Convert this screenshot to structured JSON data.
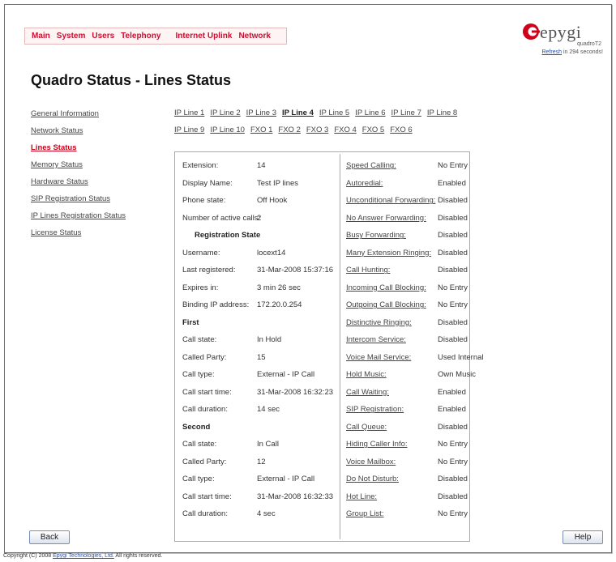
{
  "topnav": [
    "Main",
    "System",
    "Users",
    "Telephony",
    "Internet Uplink",
    "Network"
  ],
  "logo": {
    "brand": "epygi",
    "model": "quadroT2",
    "refresh_link": "Refresh",
    "refresh_rest": "in 294 seconds!",
    "mark_color": "#d0021b"
  },
  "page_title": "Quadro Status - Lines Status",
  "sidebar": [
    "General Information",
    "Network Status",
    "Lines Status",
    "Memory Status",
    "Hardware Status",
    "SIP Registration Status",
    "IP Lines Registration Status",
    "License Status"
  ],
  "sidebar_active_index": 2,
  "line_tabs_row1": [
    "IP Line 1",
    "IP Line 2",
    "IP Line 3",
    "IP Line 4",
    "IP Line 5",
    "IP Line 6",
    "IP Line 7",
    "IP Line 8"
  ],
  "line_tabs_row2": [
    "IP Line 9",
    "IP Line 10",
    "FXO 1",
    "FXO 2",
    "FXO 3",
    "FXO 4",
    "FXO 5",
    "FXO 6"
  ],
  "line_tabs_current": "IP Line 4",
  "status_left": [
    {
      "label": "Extension:",
      "value": "14"
    },
    {
      "label": "Display Name:",
      "value": "Test IP lines"
    },
    {
      "label": "Phone state:",
      "value": "Off Hook"
    },
    {
      "label": "Number of active calls:",
      "value": "2"
    },
    {
      "section": "Registration State",
      "indent": true
    },
    {
      "label": "Username:",
      "value": "locext14"
    },
    {
      "label": "Last registered:",
      "value": "31-Mar-2008 15:37:16"
    },
    {
      "label": "Expires in:",
      "value": "3 min 26 sec"
    },
    {
      "label": "Binding IP address:",
      "value": "172.20.0.254"
    },
    {
      "section": "First",
      "indent": false
    },
    {
      "label": "Call state:",
      "value": "In Hold"
    },
    {
      "label": "Called Party:",
      "value": "15"
    },
    {
      "label": "Call type:",
      "value": "External - IP Call"
    },
    {
      "label": "Call start time:",
      "value": "31-Mar-2008 16:32:23"
    },
    {
      "label": "Call duration:",
      "value": "14 sec"
    },
    {
      "section": "Second",
      "indent": false
    },
    {
      "label": "Call state:",
      "value": "In Call"
    },
    {
      "label": "Called Party:",
      "value": "12"
    },
    {
      "label": "Call type:",
      "value": "External - IP Call"
    },
    {
      "label": "Call start time:",
      "value": "31-Mar-2008 16:32:33"
    },
    {
      "label": "Call duration:",
      "value": "4 sec"
    }
  ],
  "status_right": [
    {
      "label": "Speed Calling:",
      "value": "No Entry"
    },
    {
      "label": "Autoredial:",
      "value": "Enabled"
    },
    {
      "label": "Unconditional Forwarding:",
      "value": "Disabled"
    },
    {
      "label": "No Answer Forwarding:",
      "value": "Disabled"
    },
    {
      "label": "Busy Forwarding:",
      "value": "Disabled"
    },
    {
      "label": "Many Extension Ringing:",
      "value": "Disabled"
    },
    {
      "label": "Call Hunting:",
      "value": "Disabled"
    },
    {
      "label": "Incoming Call Blocking:",
      "value": "No Entry"
    },
    {
      "label": "Outgoing Call Blocking:",
      "value": "No Entry"
    },
    {
      "label": "Distinctive Ringing:",
      "value": "Disabled"
    },
    {
      "label": "Intercom Service:",
      "value": "Disabled"
    },
    {
      "label": "Voice Mail Service:",
      "value": "Used Internal"
    },
    {
      "label": "Hold Music:",
      "value": "Own Music"
    },
    {
      "label": "Call Waiting:",
      "value": "Enabled"
    },
    {
      "label": "SIP Registration:",
      "value": "Enabled"
    },
    {
      "label": "Call Queue:",
      "value": "Disabled"
    },
    {
      "label": "Hiding Caller Info:",
      "value": "No Entry"
    },
    {
      "label": "Voice Mailbox:",
      "value": "No Entry"
    },
    {
      "label": "Do Not Disturb:",
      "value": "Disabled"
    },
    {
      "label": "Hot Line:",
      "value": "Disabled"
    },
    {
      "label": "Group List:",
      "value": "No Entry"
    }
  ],
  "buttons": {
    "back": "Back",
    "help": "Help"
  },
  "copyright": {
    "pre": "Copyright (C) 2008",
    "link": "Epygi Technologies, Ltd.",
    "post": "All rights reserved."
  }
}
